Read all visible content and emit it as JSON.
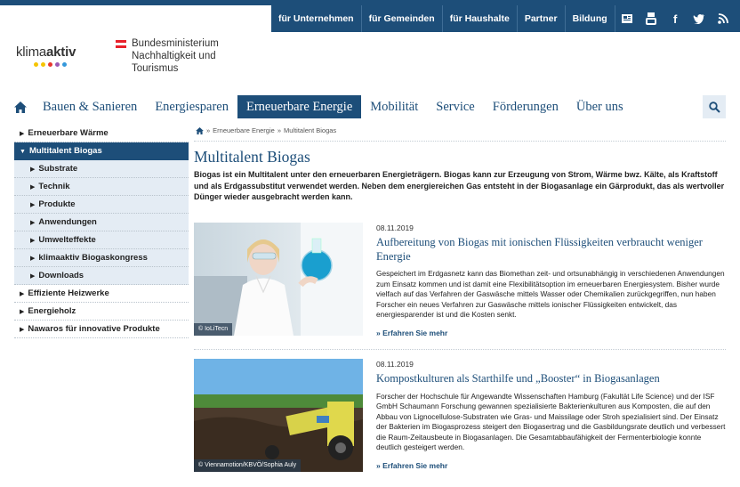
{
  "utility_nav": {
    "links": [
      "für Unternehmen",
      "für Gemeinden",
      "für Haushalte",
      "Partner",
      "Bildung"
    ],
    "icons": [
      "newsletter-icon",
      "youtube-icon",
      "facebook-icon",
      "twitter-icon",
      "rss-icon"
    ]
  },
  "logo": {
    "part1": "klima",
    "part2": "aktiv",
    "dot_colors": [
      "#f5c400",
      "#f5c400",
      "#e7372f",
      "#9b59b6",
      "#3498db"
    ]
  },
  "ministry": {
    "line1": "Bundesministerium",
    "line2": "Nachhaltigkeit und",
    "line3": "Tourismus",
    "flag_colors": [
      "#e8202a",
      "#ffffff",
      "#e8202a"
    ]
  },
  "main_nav": {
    "items": [
      "Bauen & Sanieren",
      "Energiesparen",
      "Erneuerbare Energie",
      "Mobilität",
      "Service",
      "Förderungen",
      "Über uns"
    ],
    "active": "Erneuerbare Energie"
  },
  "sidebar": {
    "items": [
      {
        "label": "Erneuerbare Wärme",
        "type": "top"
      },
      {
        "label": "Multitalent Biogas",
        "type": "active"
      },
      {
        "label": "Substrate",
        "type": "sub"
      },
      {
        "label": "Technik",
        "type": "sub"
      },
      {
        "label": "Produkte",
        "type": "sub"
      },
      {
        "label": "Anwendungen",
        "type": "sub"
      },
      {
        "label": "Umwelteffekte",
        "type": "sub"
      },
      {
        "label": "klimaaktiv Biogaskongress",
        "type": "sub"
      },
      {
        "label": "Downloads",
        "type": "sub"
      },
      {
        "label": "Effiziente Heizwerke",
        "type": "top"
      },
      {
        "label": "Energieholz",
        "type": "top"
      },
      {
        "label": "Nawaros für innovative Produkte",
        "type": "top"
      }
    ]
  },
  "breadcrumb": {
    "items": [
      "Erneuerbare Energie",
      "Multitalent Biogas"
    ],
    "separator": "»"
  },
  "page": {
    "title": "Multitalent Biogas",
    "intro": "Biogas ist ein Multitalent unter den erneuerbaren Energieträgern. Biogas kann zur Erzeugung von Strom, Wärme bwz. Kälte, als Kraftstoff und als Erdgassubstitut verwendet werden. Neben dem energiereichen Gas entsteht in der Biogasanlage ein Gärprodukt, das als wertvoller Dünger wieder ausgebracht werden kann."
  },
  "articles": [
    {
      "date": "08.11.2019",
      "title": "Aufbereitung von Biogas mit ionischen Flüssigkeiten verbraucht weniger Energie",
      "body": "Gespeichert im Erdgasnetz kann das Biomethan zeit- und ortsunabhängig in verschiedenen Anwendungen zum Einsatz kommen und ist damit eine Flexibilitätsoption im erneuerbaren Energiesystem. Bisher wurde vielfach auf das Verfahren der Gaswäsche mittels Wasser oder Chemikalien zurückgegriffen, nun haben Forscher ein neues Verfahren zur Gaswäsche mittels ionischer Flüssigkeiten entwickelt, das energiesparender ist und die Kosten senkt.",
      "more": "» Erfahren Sie mehr",
      "image_credit": "© IoLiTecn"
    },
    {
      "date": "08.11.2019",
      "title": "Kompostkulturen als Starthilfe und „Booster“ in Biogasanlagen",
      "body": "Forscher der Hochschule für Angewandte Wissenschaften Hamburg (Fakultät Life Science) und der ISF GmbH Schaumann Forschung gewannen spezialisierte Bakterienkulturen aus Komposten, die auf den Abbau von Lignocellulose-Substraten wie Gras- und Maissilage oder Stroh spezialisiert sind. Der Einsatz der Bakterien im Biogasprozess steigert den Biogasertrag und die Gasbildungsrate deutlich und verbessert die Raum-Zeitausbeute in Biogasanlagen. Die Gesamtabbaufähigkeit der Fermenterbiologie konnte deutlich gesteigert werden.",
      "more": "» Erfahren Sie mehr",
      "image_credit": "© Viennamotion/KBVÖ/Sophia Auly"
    }
  ],
  "colors": {
    "primary": "#1d4e79",
    "sidebar_sub_bg": "#e4ecf4"
  }
}
